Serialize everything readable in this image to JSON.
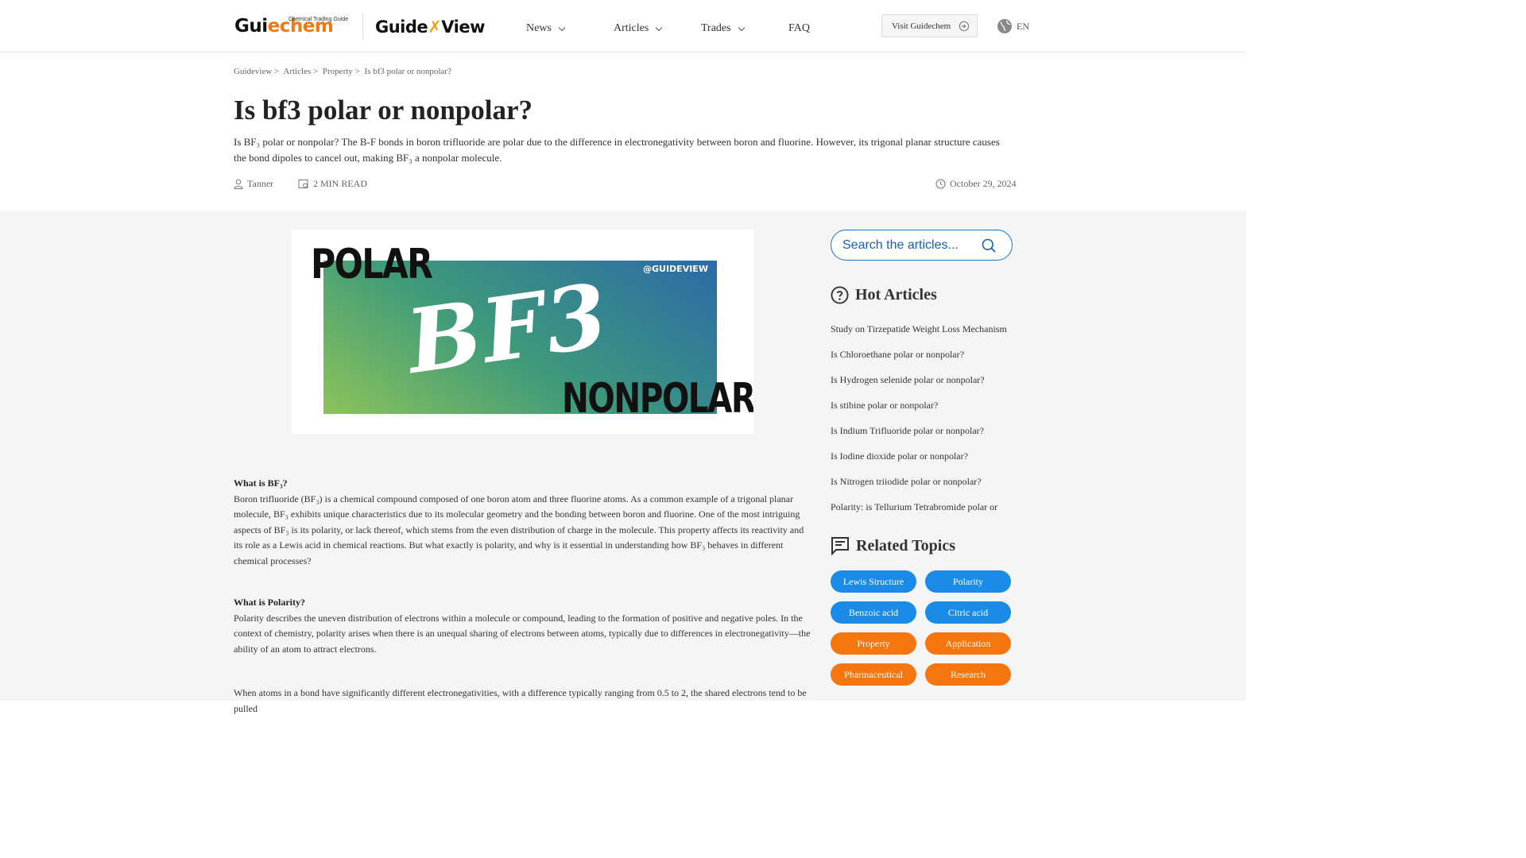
{
  "header": {
    "logo_guidechem": {
      "text_a": "Gui",
      "text_b": "e",
      "text_c": "chem",
      "tagline": "Chemical Trading Guide"
    },
    "logo_guideview": {
      "text_a": "Guide",
      "text_x": "✗",
      "text_b": "View"
    },
    "nav": [
      {
        "label": "News",
        "dropdown": true
      },
      {
        "label": "Articles",
        "dropdown": true
      },
      {
        "label": "Trades",
        "dropdown": true
      },
      {
        "label": "FAQ",
        "dropdown": false
      }
    ],
    "visit_button": "Visit Guidechem",
    "language": "EN"
  },
  "breadcrumb": [
    "Guideview >",
    "Articles >",
    "Property >",
    "Is bf3 polar or nonpolar?"
  ],
  "article": {
    "title": "Is bf3 polar or nonpolar?",
    "summary": "Is BF₃ polar or nonpolar? The B-F bonds in boron trifluoride are polar due to the difference in electronegativity between boron and fluorine. However, its trigonal planar structure causes the bond dipoles to cancel out, making BF₃ a nonpolar molecule.",
    "author": "Tanner",
    "read_time": "2 MIN READ",
    "date": "October 29, 2024",
    "hero": {
      "top_text": "POLAR",
      "center_text": "BF3",
      "bottom_text": "NONPOLAR",
      "watermark": "@GUIDEVIEW"
    },
    "sections": [
      {
        "heading": "What is BF₃?",
        "text": "Boron trifluoride (BF₃) is a chemical compound composed of one boron atom and three fluorine atoms. As a common example of a trigonal planar molecule, BF₃ exhibits unique characteristics due to its molecular geometry and the bonding between boron and fluorine. One of the most intriguing aspects of BF₃ is its polarity, or lack thereof, which stems from the even distribution of charge in the molecule. This property affects its reactivity and its role as a Lewis acid in chemical reactions. But what exactly is polarity, and why is it essential in understanding how BF₃ behaves in different chemical processes?"
      },
      {
        "heading": "What is Polarity?",
        "text": "Polarity describes the uneven distribution of electrons within a molecule or compound, leading to the formation of positive and negative poles. In the context of chemistry, polarity arises when there is an unequal sharing of electrons between atoms, typically due to differences in electronegativity—the ability of an atom to attract electrons."
      },
      {
        "heading": "",
        "text": "When atoms in a bond have significantly different electronegativities, with a difference typically ranging from 0.5 to 2, the shared electrons tend to be pulled"
      }
    ]
  },
  "sidebar": {
    "search_placeholder": "Search the articles...",
    "hot_title": "Hot Articles",
    "hot_articles": [
      "Study on Tirzepatide Weight Loss Mechanism",
      "Is Chloroethane polar or nonpolar?",
      "Is Hydrogen selenide polar or nonpolar?",
      "Is stibine polar or nonpolar?",
      "Is Indium Trifluoride polar or nonpolar?",
      "Is Iodine dioxide polar or nonpolar?",
      "Is Nitrogen triiodide polar or nonpolar?",
      "Polarity: is Tellurium Tetrabromide polar or"
    ],
    "topics_title": "Related Topics",
    "topics": [
      {
        "label": "Lewis Structure",
        "color": "#1a8ce8"
      },
      {
        "label": "Polarity",
        "color": "#1a8ce8"
      },
      {
        "label": "Benzoic acid",
        "color": "#1a8ce8"
      },
      {
        "label": "Citric acid",
        "color": "#1a8ce8"
      },
      {
        "label": "Property",
        "color": "#f5760f"
      },
      {
        "label": "Application",
        "color": "#f5760f"
      },
      {
        "label": "Pharmaceutical",
        "color": "#f5760f"
      },
      {
        "label": "Research",
        "color": "#f5760f"
      }
    ]
  }
}
